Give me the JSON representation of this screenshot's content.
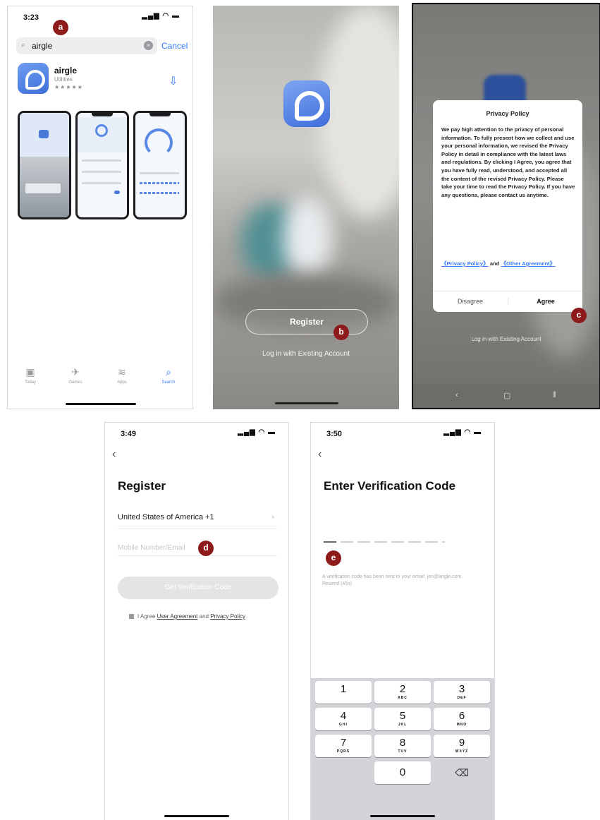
{
  "markers": {
    "a": "a",
    "b": "b",
    "c": "c",
    "d": "d",
    "e": "e"
  },
  "screen_a": {
    "time": "3:23",
    "search_query": "airgle",
    "cancel_label": "Cancel",
    "app_name": "airgle",
    "app_category": "Utilities",
    "app_rating": "★★★★★",
    "tabs": [
      "Today",
      "Games",
      "Apps",
      "Search"
    ]
  },
  "screen_b": {
    "register_label": "Register",
    "login_label": "Log in with Existing Account"
  },
  "screen_c": {
    "dialog_title": "Privacy Policy",
    "dialog_body": "We pay high attention to the privacy of personal information. To fully present how we collect and use your personal information, we revised the Privacy Policy in detail in compliance with the latest laws and regulations. By clicking I Agree, you agree that you have fully read, understood, and accepted all the content of the revised Privacy Policy. Please take your time to read the Privacy Policy. If you have any questions, please contact us anytime.",
    "link_privacy": "《Privacy Policy》",
    "link_and": " and ",
    "link_other": "《Other Agreement》",
    "disagree_label": "Disagree",
    "agree_label": "Agree",
    "login_label": "Log in with Existing Account"
  },
  "screen_d": {
    "time": "3:49",
    "title": "Register",
    "country": "United States of America +1",
    "phone_placeholder": "Mobile Number/Email",
    "get_code_label": "Get Verification Code",
    "agree_prefix": "I Agree ",
    "user_agreement": "User Agreement",
    "agree_and": " and ",
    "privacy_policy": "Privacy Policy"
  },
  "screen_e": {
    "time": "3:50",
    "title": "Enter Verification Code",
    "hint": "A verification code has been sent to your email: jen@airgle.com. Resend (45s)",
    "keys": [
      {
        "n": "1",
        "l": ""
      },
      {
        "n": "2",
        "l": "ABC"
      },
      {
        "n": "3",
        "l": "DEF"
      },
      {
        "n": "4",
        "l": "GHI"
      },
      {
        "n": "5",
        "l": "JKL"
      },
      {
        "n": "6",
        "l": "MNO"
      },
      {
        "n": "7",
        "l": "PQRS"
      },
      {
        "n": "8",
        "l": "TUV"
      },
      {
        "n": "9",
        "l": "WXYZ"
      },
      {
        "n": "0",
        "l": ""
      }
    ]
  }
}
